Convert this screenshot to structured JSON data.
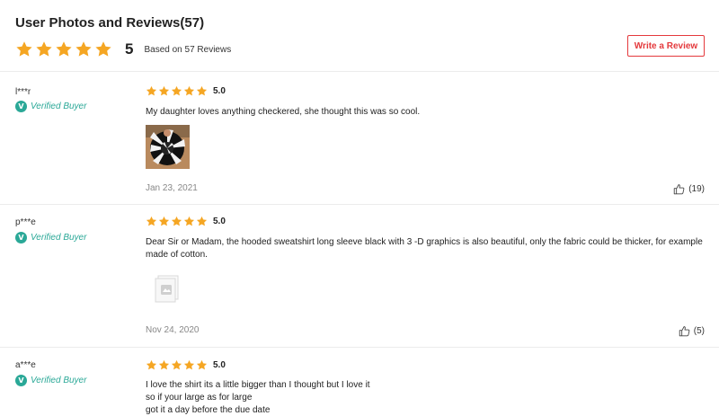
{
  "header": {
    "title": "User Photos and Reviews(57)",
    "average_rating": "5",
    "based_on": "Based on 57 Reviews",
    "write_review_label": "Write a Review"
  },
  "colors": {
    "star": "#f5a623",
    "verified": "#2aa897",
    "accent": "#e4393c"
  },
  "reviews": [
    {
      "author": "l***r",
      "verified_label": "Verified Buyer",
      "rating": "5.0",
      "text": "My daughter loves anything checkered, she thought this was so cool.",
      "attachment": "photo",
      "date": "Jan 23, 2021",
      "likes": "(19)"
    },
    {
      "author": "p***e",
      "verified_label": "Verified Buyer",
      "rating": "5.0",
      "text": "Dear Sir or Madam, the hooded sweatshirt long sleeve black with 3 -D graphics is also beautiful, only the fabric could be thicker, for example made of cotton.",
      "attachment": "image-placeholder-icon",
      "date": "Nov 24, 2020",
      "likes": "(5)"
    },
    {
      "author": "a***e",
      "verified_label": "Verified Buyer",
      "rating": "5.0",
      "text_lines": [
        "I love the shirt its a little bigger than I thought but I love it",
        "so if your large as for large",
        "got it a day before the due date"
      ]
    }
  ]
}
